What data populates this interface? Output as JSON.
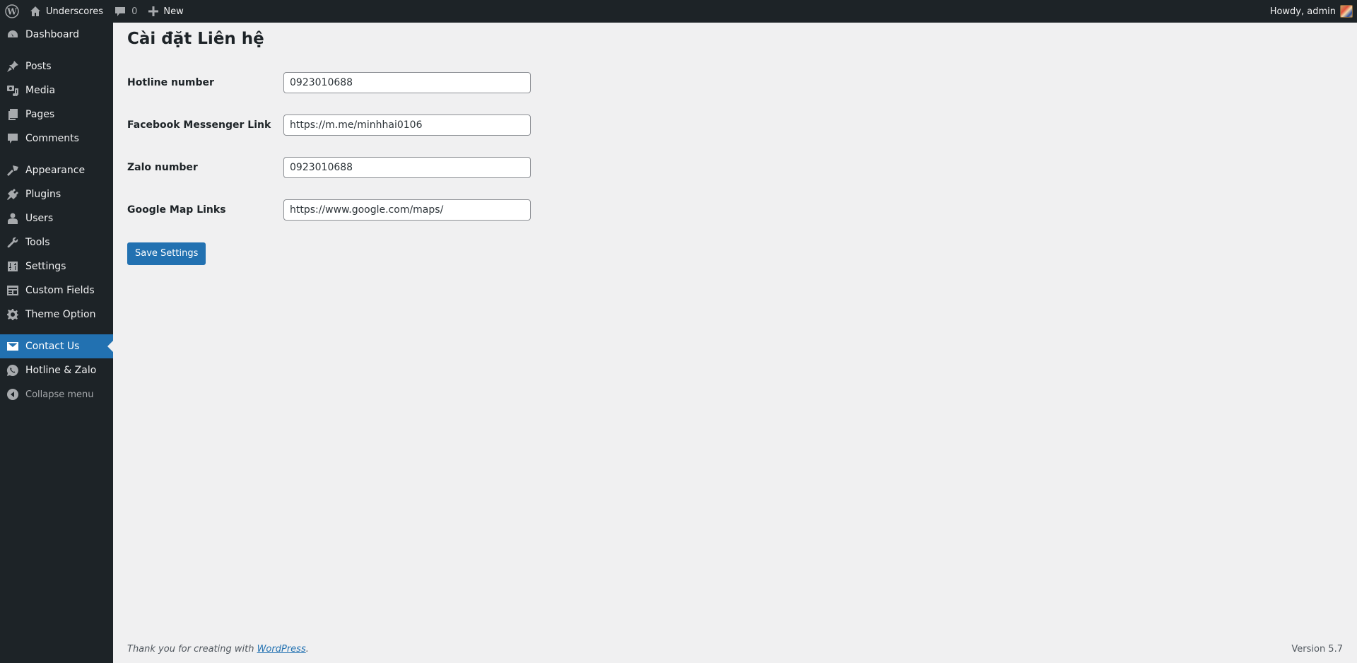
{
  "adminbar": {
    "site_name": "Underscores",
    "comments_count": "0",
    "new_label": "New",
    "greeting": "Howdy, admin"
  },
  "sidebar": {
    "items": [
      {
        "label": "Dashboard",
        "icon": "dashboard-icon"
      },
      {
        "label": "Posts",
        "icon": "pin-icon"
      },
      {
        "label": "Media",
        "icon": "media-icon"
      },
      {
        "label": "Pages",
        "icon": "pages-icon"
      },
      {
        "label": "Comments",
        "icon": "comment-icon"
      },
      {
        "label": "Appearance",
        "icon": "paintbrush-icon"
      },
      {
        "label": "Plugins",
        "icon": "plug-icon"
      },
      {
        "label": "Users",
        "icon": "user-icon"
      },
      {
        "label": "Tools",
        "icon": "wrench-icon"
      },
      {
        "label": "Settings",
        "icon": "sliders-icon"
      },
      {
        "label": "Custom Fields",
        "icon": "table-icon"
      },
      {
        "label": "Theme Option",
        "icon": "gear-icon"
      },
      {
        "label": "Contact Us",
        "icon": "envelope-icon",
        "current": true
      },
      {
        "label": "Hotline & Zalo",
        "icon": "whatsapp-icon"
      }
    ],
    "collapse_label": "Collapse menu"
  },
  "main": {
    "title": "Cài đặt Liên hệ",
    "fields": [
      {
        "label": "Hotline number",
        "value": "0923010688"
      },
      {
        "label": "Facebook Messenger Link",
        "value": "https://m.me/minhhai0106"
      },
      {
        "label": "Zalo number",
        "value": "0923010688"
      },
      {
        "label": "Google Map Links",
        "value": "https://www.google.com/maps/"
      }
    ],
    "save_label": "Save Settings"
  },
  "footer": {
    "thanks_text": "Thank you for creating with ",
    "link_text": "WordPress",
    "suffix": ".",
    "version": "Version 5.7"
  },
  "colors": {
    "accent": "#2271b1",
    "sidebar_bg": "#1d2327",
    "content_bg": "#f0f0f1"
  }
}
